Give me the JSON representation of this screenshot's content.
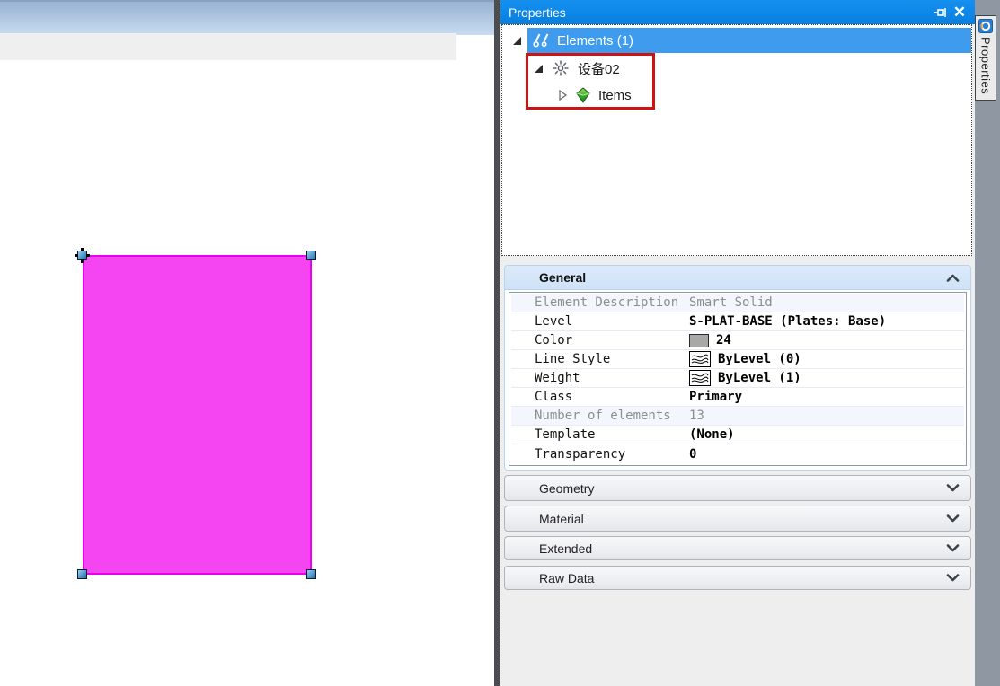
{
  "colors": {
    "titlebar_blue": "#0c86e8",
    "tree_selection_blue": "#3e9bed",
    "annotation_red": "#cf1313",
    "selected_shape_fill": "#f544f2",
    "selected_shape_border": "#ea00ea",
    "handle_blue": "#5aa2d2",
    "color_swatch_gray": "#a8a8a8",
    "dock_strip_gray": "#8f98a2"
  },
  "panel": {
    "titlebar": {
      "title": "Properties"
    },
    "tree": {
      "items": [
        {
          "label": "Elements (1)",
          "state": "expanded",
          "selected": true
        },
        {
          "label": "设备02",
          "state": "expanded",
          "selected": false
        },
        {
          "label": "Items",
          "state": "collapsed",
          "selected": false
        }
      ]
    },
    "general": {
      "label": "General",
      "state": "expanded",
      "rows": [
        {
          "label": "Element Description",
          "value": "Smart Solid",
          "readonly": true
        },
        {
          "label": "Level",
          "value": "S-PLAT-BASE (Plates: Base)"
        },
        {
          "label": "Color",
          "value": "24",
          "icon": "color-swatch"
        },
        {
          "label": "Line Style",
          "value": "ByLevel (0)",
          "icon": "line-style-preview"
        },
        {
          "label": "Weight",
          "value": "ByLevel (1)",
          "icon": "line-weight-preview"
        },
        {
          "label": "Class",
          "value": "Primary"
        },
        {
          "label": "Number of elements",
          "value": "13",
          "readonly": true
        },
        {
          "label": "Template",
          "value": "(None)"
        },
        {
          "label": "Transparency",
          "value": "0"
        }
      ]
    },
    "collapsed_sections": [
      {
        "label": "Geometry"
      },
      {
        "label": "Material"
      },
      {
        "label": "Extended"
      },
      {
        "label": "Raw Data"
      }
    ],
    "side_tab": {
      "label": "Properties"
    }
  }
}
